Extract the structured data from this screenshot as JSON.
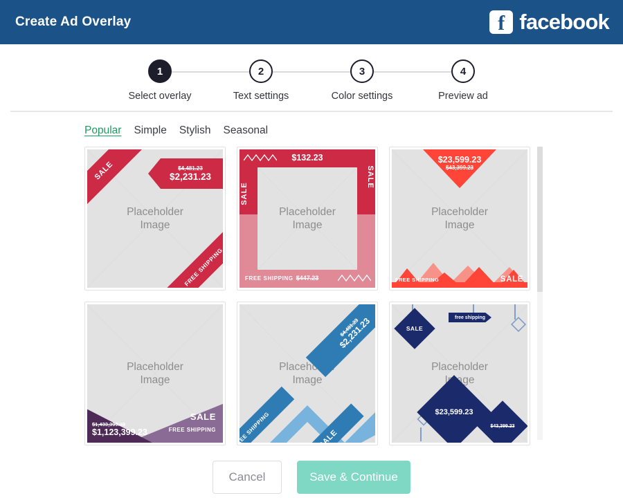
{
  "header": {
    "title": "Create Ad Overlay",
    "brand": "facebook",
    "brand_mark": "facebook-f-icon",
    "background": "#1b5288"
  },
  "steps": [
    {
      "number": "1",
      "label": "Select overlay",
      "active": true
    },
    {
      "number": "2",
      "label": "Text settings",
      "active": false
    },
    {
      "number": "3",
      "label": "Color settings",
      "active": false
    },
    {
      "number": "4",
      "label": "Preview ad",
      "active": false
    }
  ],
  "tabs": [
    {
      "label": "Popular",
      "active": true
    },
    {
      "label": "Simple",
      "active": false
    },
    {
      "label": "Stylish",
      "active": false
    },
    {
      "label": "Seasonal",
      "active": false
    }
  ],
  "placeholder": {
    "line1": "Placeholder",
    "line2": "Image"
  },
  "templates": [
    {
      "id": "crimson-corner-ribbons",
      "style": "corner-ribbons",
      "accent": "#cc2a45",
      "sale_label": "SALE",
      "shipping_label": "FREE SHIPPING",
      "price_old": "$4,481.23",
      "price_new": "$2,231.23"
    },
    {
      "id": "crimson-frame",
      "style": "frame",
      "accent": "#cc2a45",
      "accent_light": "#e08a98",
      "sale_label": "SALE",
      "shipping_label": "FREE SHIPPING",
      "price_top": "$132.23",
      "price_bottom": "$447.23"
    },
    {
      "id": "red-triangles",
      "style": "triangles",
      "accent": "#ff4438",
      "accent_light": "#f79289",
      "sale_label": "SALE",
      "shipping_label": "FREE SHIPPING",
      "price_new": "$23,599.23",
      "price_old": "$43,399.23"
    },
    {
      "id": "purple-chevron",
      "style": "chevron",
      "accent": "#5a2d5e",
      "accent_light": "#8a6b95",
      "sale_label": "SALE",
      "shipping_label": "FREE SHIPPING",
      "price_old": "$1,433,399.23",
      "price_new": "$1,123,399.23"
    },
    {
      "id": "blue-diagonals",
      "style": "diagonals",
      "accent": "#2f7cb5",
      "accent_light": "#77b3dd",
      "sale_label": "SALE",
      "shipping_label": "FREE SHIPPING",
      "price_old": "$4,481.23",
      "price_new": "$2,231.23"
    },
    {
      "id": "navy-diamonds",
      "style": "diamonds",
      "accent": "#1b2a6b",
      "sale_label": "SALE",
      "shipping_label": "free shipping",
      "price_new": "$23,599.23",
      "price_old": "$43,399.23"
    }
  ],
  "footer": {
    "cancel_label": "Cancel",
    "save_label": "Save & Continue",
    "save_color": "#7ed8c3"
  }
}
